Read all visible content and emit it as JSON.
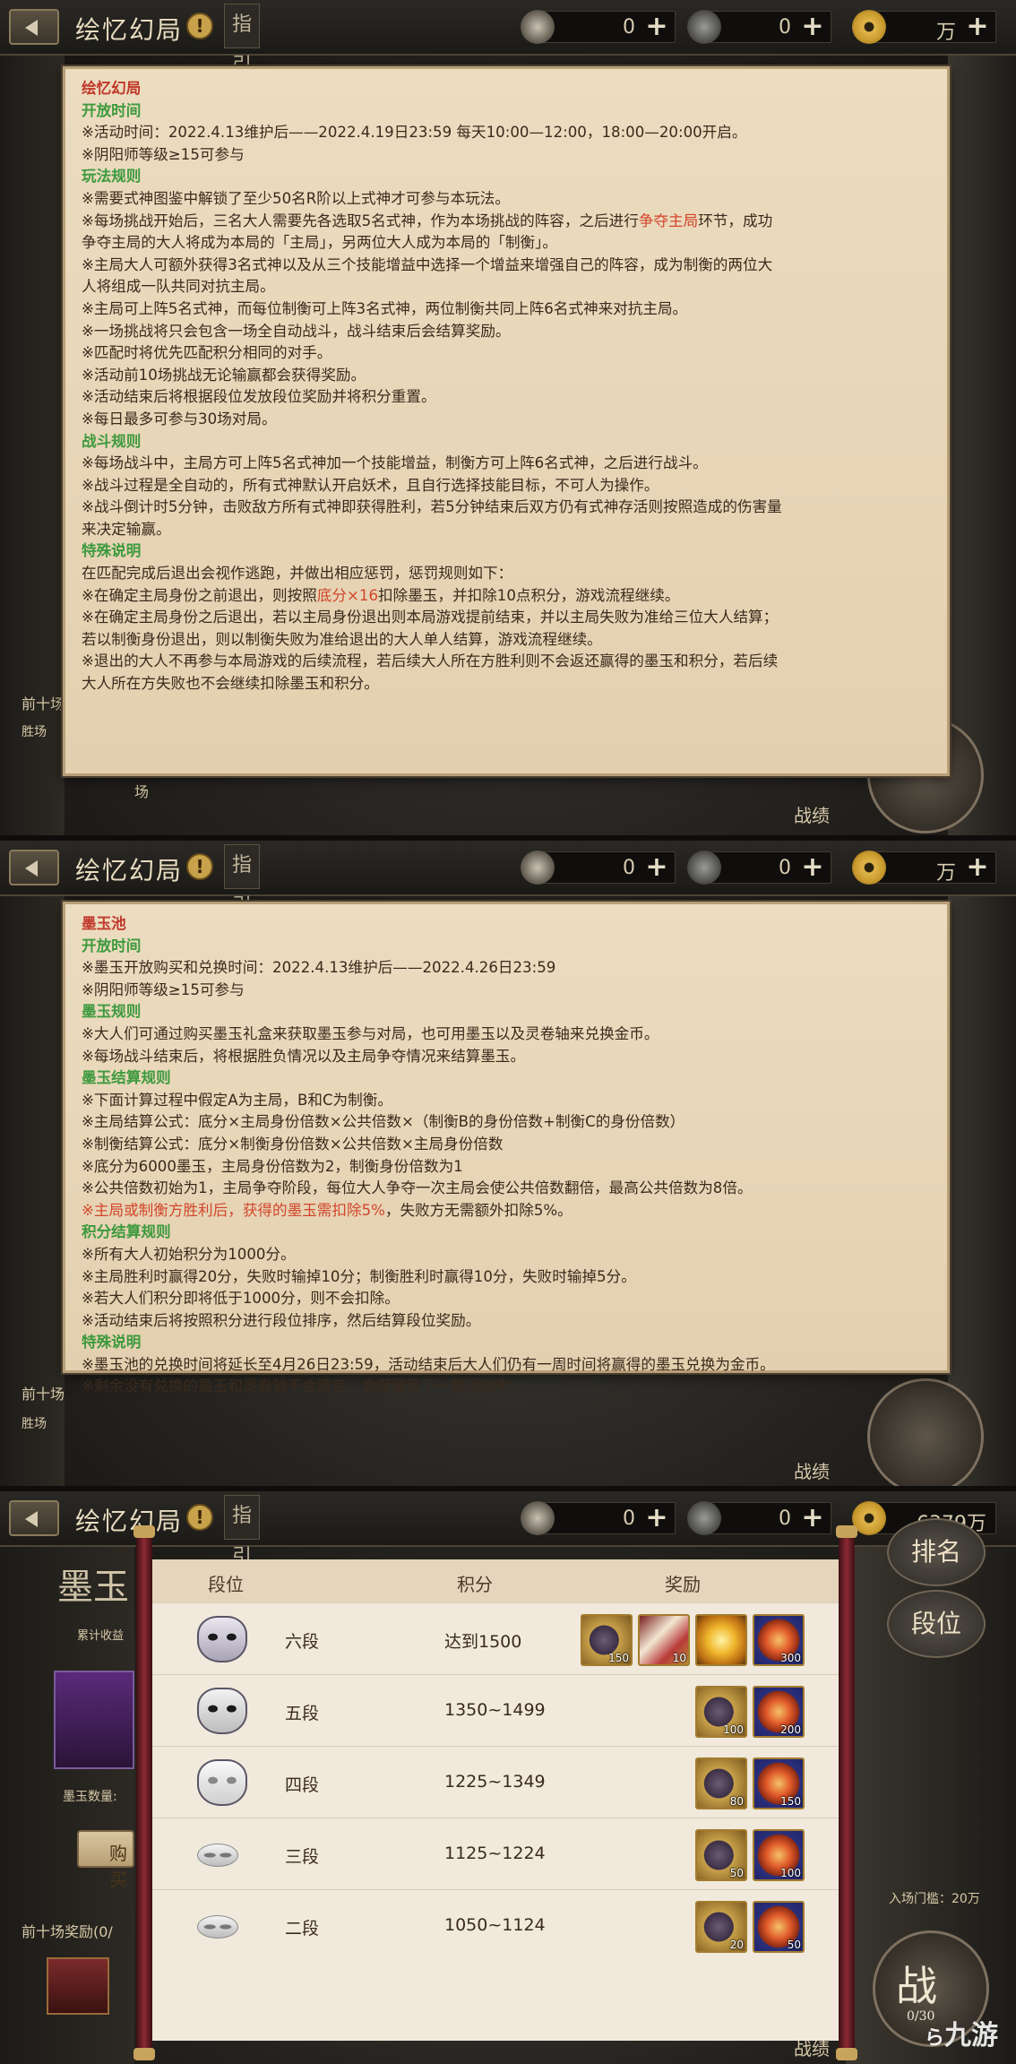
{
  "topbar": {
    "title": "绘忆幻局",
    "warn_icon": "!",
    "guide": "指引",
    "res_scroll": "0",
    "res_jade": "0",
    "res_coin_unit": "万",
    "res_coin_p3": "6379万",
    "plus": "+"
  },
  "panel1": {
    "lines": [
      {
        "cls": "hd-red",
        "text": "绘忆幻局"
      },
      {
        "cls": "hd-green",
        "text": "开放时间"
      },
      {
        "text": "※活动时间：2022.4.13维护后——2022.4.19日23:59 每天10:00—12:00，18:00—20:00开启。"
      },
      {
        "text": "※阴阳师等级≥15可参与"
      },
      {
        "cls": "hd-green",
        "text": "玩法规则"
      },
      {
        "text": "※需要式神图鉴中解锁了至少50名R阶以上式神才可参与本玩法。"
      },
      {
        "pre": "※每场挑战开始后，三名大人需要先各选取5名式神，作为本场挑战的阵容，之后进行",
        "hl": "争夺主局",
        "post": "环节，成功"
      },
      {
        "text": "争夺主局的大人将成为本局的「主局」，另两位大人成为本局的「制衡」。"
      },
      {
        "text": "※主局大人可额外获得3名式神以及从三个技能增益中选择一个增益来增强自己的阵容，成为制衡的两位大"
      },
      {
        "text": "人将组成一队共同对抗主局。"
      },
      {
        "text": "※主局可上阵5名式神，而每位制衡可上阵3名式神，两位制衡共同上阵6名式神来对抗主局。"
      },
      {
        "text": "※一场挑战将只会包含一场全自动战斗，战斗结束后会结算奖励。"
      },
      {
        "text": "※匹配时将优先匹配积分相同的对手。"
      },
      {
        "text": "※活动前10场挑战无论输赢都会获得奖励。"
      },
      {
        "text": "※活动结束后将根据段位发放段位奖励并将积分重置。"
      },
      {
        "text": "※每日最多可参与30场对局。"
      },
      {
        "cls": "hd-green",
        "text": "战斗规则"
      },
      {
        "text": "※每场战斗中，主局方可上阵5名式神加一个技能增益，制衡方可上阵6名式神，之后进行战斗。"
      },
      {
        "text": "※战斗过程是全自动的，所有式神默认开启妖术，且自行选择技能目标，不可人为操作。"
      },
      {
        "text": "※战斗倒计时5分钟，击败敌方所有式神即获得胜利，若5分钟结束后双方仍有式神存活则按照造成的伤害量"
      },
      {
        "text": "来决定输赢。"
      },
      {
        "cls": "hd-green",
        "text": "特殊说明"
      },
      {
        "text": "在匹配完成后退出会视作逃跑，并做出相应惩罚，惩罚规则如下："
      },
      {
        "pre": "※在确定主局身份之前退出，则按照",
        "hl": "底分×16",
        "post": "扣除墨玉，并扣除10点积分，游戏流程继续。"
      },
      {
        "text": "※在确定主局身份之后退出，若以主局身份退出则本局游戏提前结束，并以主局失败为准给三位大人结算；"
      },
      {
        "text": "若以制衡身份退出，则以制衡失败为准给退出的大人单人结算，游戏流程继续。"
      },
      {
        "text": "※退出的大人不再参与本局游戏的后续流程，若后续大人所在方胜利则不会返还赢得的墨玉和积分，若后续"
      },
      {
        "text": "大人所在方失败也不会继续扣除墨玉和积分。"
      }
    ],
    "bg_top10": "前十场",
    "bg_win": "胜场",
    "bg_field": "场",
    "bg_record": "战绩"
  },
  "panel2": {
    "lines": [
      {
        "cls": "hd-red",
        "text": "墨玉池"
      },
      {
        "cls": "hd-green",
        "text": "开放时间"
      },
      {
        "text": "※墨玉开放购买和兑换时间：2022.4.13维护后——2022.4.26日23:59"
      },
      {
        "text": "※阴阳师等级≥15可参与"
      },
      {
        "cls": "hd-green",
        "text": "墨玉规则"
      },
      {
        "text": "※大人们可通过购买墨玉礼盒来获取墨玉参与对局，也可用墨玉以及灵卷轴来兑换金币。"
      },
      {
        "text": "※每场战斗结束后，将根据胜负情况以及主局争夺情况来结算墨玉。"
      },
      {
        "cls": "hd-green",
        "text": "墨玉结算规则"
      },
      {
        "text": "※下面计算过程中假定A为主局，B和C为制衡。"
      },
      {
        "text": "※主局结算公式：底分×主局身份倍数×公共倍数×（制衡B的身份倍数+制衡C的身份倍数）"
      },
      {
        "text": "※制衡结算公式：底分×制衡身份倍数×公共倍数×主局身份倍数"
      },
      {
        "text": "※底分为6000墨玉，主局身份倍数为2，制衡身份倍数为1"
      },
      {
        "text": "※公共倍数初始为1，主局争夺阶段，每位大人争夺一次主局会使公共倍数翻倍，最高公共倍数为8倍。"
      },
      {
        "pre": "",
        "hl": "※主局或制衡方胜利后，获得的墨玉需扣除5%",
        "post": "，失败方无需额外扣除5%。"
      },
      {
        "cls": "hd-green",
        "text": "积分结算规则"
      },
      {
        "text": "※所有大人初始积分为1000分。"
      },
      {
        "text": "※主局胜利时赢得20分，失败时输掉10分；制衡胜利时赢得10分，失败时输掉5分。"
      },
      {
        "text": "※若大人们积分即将低于1000分，则不会扣除。"
      },
      {
        "text": "※活动结束后将按照积分进行段位排序，然后结算段位奖励。"
      },
      {
        "cls": "hd-green",
        "text": "特殊说明"
      },
      {
        "text": "※墨玉池的兑换时间将延长至4月26日23:59，活动结束后大人们仍有一周时间将赢得的墨玉兑换为金币。"
      },
      {
        "text": "※剩余没有兑换的墨玉和灵卷轴不会清空，会保留至下一期活动中。"
      }
    ],
    "bg_top10": "前十场",
    "bg_win": "胜场",
    "bg_record": "战绩"
  },
  "panel3": {
    "headers": {
      "rank": "段位",
      "points": "积分",
      "reward": "奖励"
    },
    "rows": [
      {
        "name": "六段",
        "points": "达到1500",
        "rewards": [
          {
            "icon": "scroll-icon",
            "count": "150"
          },
          {
            "icon": "ticket-icon",
            "count": "10"
          },
          {
            "icon": "gold-icon",
            "count": ""
          },
          {
            "icon": "jade-icon",
            "count": "300"
          }
        ]
      },
      {
        "name": "五段",
        "points": "1350~1499",
        "rewards": [
          {
            "icon": "scroll-icon",
            "count": "100"
          },
          {
            "icon": "jade-icon",
            "count": "200"
          }
        ]
      },
      {
        "name": "四段",
        "points": "1225~1349",
        "rewards": [
          {
            "icon": "scroll-icon",
            "count": "80"
          },
          {
            "icon": "jade-icon",
            "count": "150"
          }
        ]
      },
      {
        "name": "三段",
        "points": "1125~1224",
        "rewards": [
          {
            "icon": "scroll-icon",
            "count": "50"
          },
          {
            "icon": "jade-icon",
            "count": "100"
          }
        ]
      },
      {
        "name": "二段",
        "points": "1050~1124",
        "rewards": [
          {
            "icon": "scroll-icon",
            "count": "20"
          },
          {
            "icon": "jade-icon",
            "count": "50"
          }
        ]
      }
    ],
    "side_rank": "排名",
    "side_tier": "段位",
    "bg_moyu": "墨玉",
    "bg_accum": "累计收益",
    "bg_moyu_count": "墨玉数量:",
    "bg_buy": "购买",
    "bg_top10": "前十场奖励(0/",
    "bg_entry": "入场门槛：20万",
    "battle": "战",
    "battle_count": "0/30",
    "bg_record": "战绩",
    "watermark": "九游"
  }
}
